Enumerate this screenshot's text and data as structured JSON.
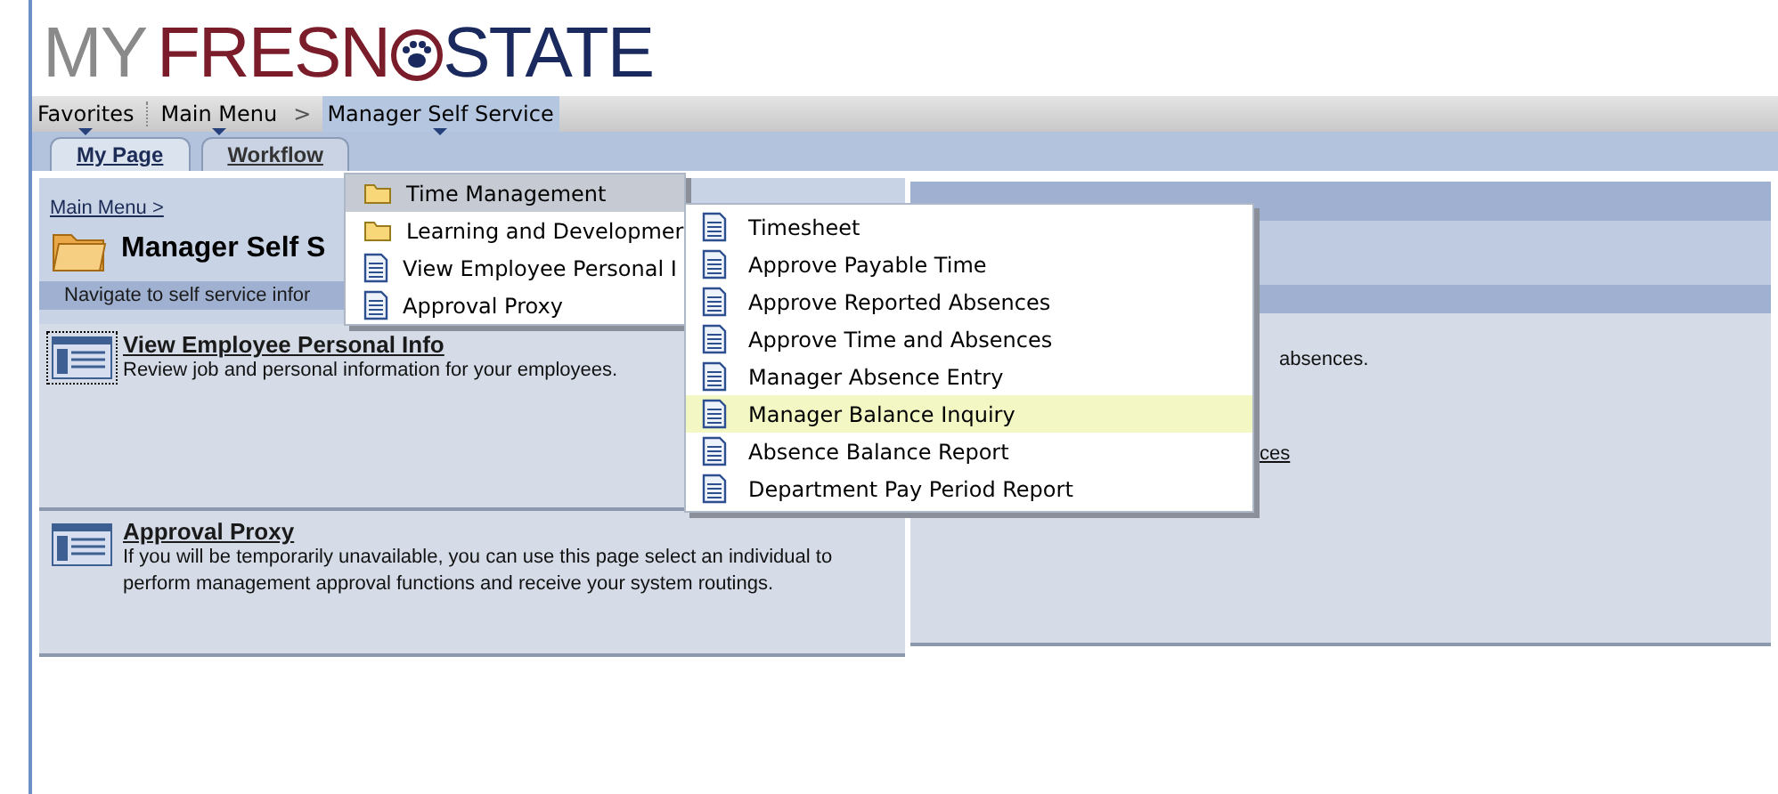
{
  "logo": {
    "parts": [
      "MY",
      "FRESN",
      "STATE"
    ]
  },
  "nav": [
    {
      "label": "Favorites",
      "selected": false
    },
    {
      "label": "Main Menu",
      "selected": false
    },
    {
      "label": "Manager Self Service",
      "selected": true
    }
  ],
  "nav_separator": ">",
  "tabs": [
    {
      "label": "My Page",
      "selected": true
    },
    {
      "label": "Workflow",
      "selected": false
    }
  ],
  "breadcrumb": "Main Menu >",
  "page_title": "Manager Self S",
  "subtitle": "Navigate to self service infor",
  "tiles": [
    {
      "title": "View Employee Personal Info",
      "description": "Review job and personal information for your employees.",
      "focused": true
    },
    {
      "title": "Approval Proxy",
      "description": "If you will be temporarily unavailable, you can use this page select an individual to perform management approval functions and receive your system routings.",
      "focused": false
    }
  ],
  "right_panel": {
    "text": "absences.",
    "link": "ces"
  },
  "menu": [
    {
      "label": "Time Management",
      "kind": "folder",
      "selected": true
    },
    {
      "label": "Learning and Developmer",
      "kind": "folder",
      "selected": false
    },
    {
      "label": "View Employee Personal I",
      "kind": "page",
      "selected": false
    },
    {
      "label": "Approval Proxy",
      "kind": "page",
      "selected": false
    }
  ],
  "submenu": [
    {
      "label": "Timesheet",
      "selected": false
    },
    {
      "label": "Approve Payable Time",
      "selected": false
    },
    {
      "label": "Approve Reported Absences",
      "selected": false
    },
    {
      "label": "Approve Time and Absences",
      "selected": false
    },
    {
      "label": "Manager Absence Entry",
      "selected": false
    },
    {
      "label": "Manager Balance Inquiry",
      "selected": true
    },
    {
      "label": "Absence Balance Report",
      "selected": false
    },
    {
      "label": "Department Pay Period Report",
      "selected": false
    }
  ]
}
